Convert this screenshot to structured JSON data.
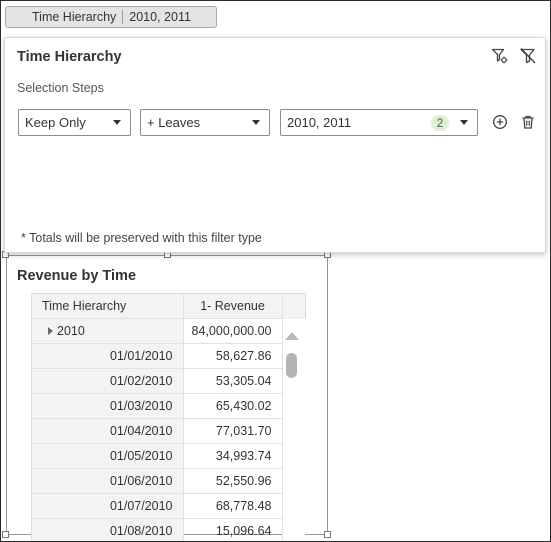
{
  "chip": {
    "label": "Time Hierarchy",
    "value": "2010, 2011"
  },
  "panel": {
    "title": "Time Hierarchy",
    "steps_label": "Selection Steps",
    "action": "Keep Only",
    "method": "+ Leaves",
    "members": "2010, 2011",
    "member_count": "2",
    "note": "* Totals will be preserved with this filter type",
    "icons": [
      "filter-settings-icon",
      "clear-filter-icon",
      "add-step-icon",
      "delete-icon"
    ]
  },
  "viz": {
    "title": "Revenue by Time",
    "columns": [
      "Time Hierarchy",
      "1- Revenue"
    ],
    "rows": [
      {
        "label": "2010",
        "value": "84,000,000.00"
      },
      {
        "label": "01/01/2010",
        "value": "58,627.86"
      },
      {
        "label": "01/02/2010",
        "value": "53,305.04"
      },
      {
        "label": "01/03/2010",
        "value": "65,430.02"
      },
      {
        "label": "01/04/2010",
        "value": "77,031.70"
      },
      {
        "label": "01/05/2010",
        "value": "34,993.74"
      },
      {
        "label": "01/06/2010",
        "value": "52,550.96"
      },
      {
        "label": "01/07/2010",
        "value": "68,778.48"
      },
      {
        "label": "01/08/2010",
        "value": "15,096.64"
      }
    ]
  },
  "colors": {
    "badge_bg": "#dff0d8",
    "viz_border": "#7fa38a"
  }
}
